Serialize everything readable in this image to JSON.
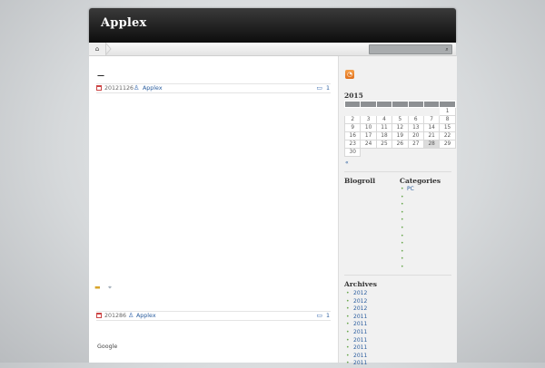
{
  "site": {
    "title": "Applex"
  },
  "nav": {
    "home_icon": "home-icon",
    "search_icon": "search-icon"
  },
  "posts": [
    {
      "title": "—",
      "date": "20121126",
      "author": "Applex",
      "comments": "1"
    },
    {
      "date": "201286",
      "author": "Applex",
      "comments": "1",
      "body_text": "Google"
    }
  ],
  "sidebar": {
    "rss_icon": "rss-icon",
    "calendar": {
      "year": "2015",
      "weeks": [
        [
          "",
          "",
          "",
          "",
          "",
          "",
          "1"
        ],
        [
          "2",
          "3",
          "4",
          "5",
          "6",
          "7",
          "8"
        ],
        [
          "9",
          "10",
          "11",
          "12",
          "13",
          "14",
          "15"
        ],
        [
          "16",
          "17",
          "18",
          "19",
          "20",
          "21",
          "22"
        ],
        [
          "23",
          "24",
          "25",
          "26",
          "27",
          "28",
          "29"
        ],
        [
          "30",
          "",
          "",
          "",
          "",
          "",
          ""
        ]
      ],
      "prev_link": "«"
    },
    "blogroll_heading": "Blogroll",
    "categories_heading": "Categories",
    "categories": [
      "PC",
      "",
      "",
      "",
      "",
      "",
      "",
      "",
      "",
      "",
      ""
    ],
    "archives_heading": "Archives",
    "archives": [
      "2012",
      "2012",
      "2012",
      "2011",
      "2011",
      "2011",
      "2011",
      "2011",
      "2011",
      "2011"
    ]
  },
  "colors": {
    "accent": "#2a5d9e",
    "header_dark": "#0d0d0d",
    "bullet_green": "#6aa84f"
  }
}
